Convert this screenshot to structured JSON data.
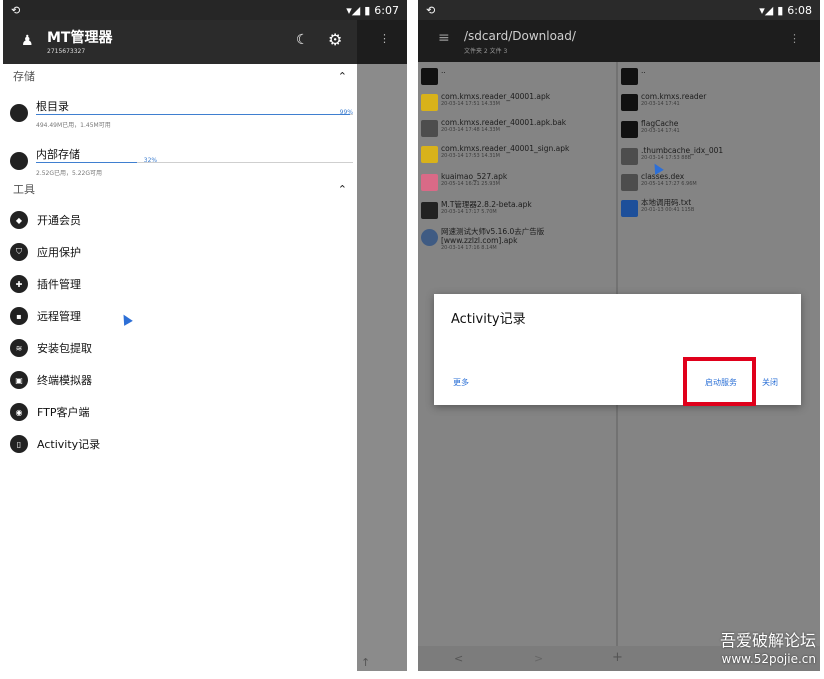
{
  "left": {
    "status": {
      "time": "6:07"
    },
    "app": {
      "title": "MT管理器",
      "subtitle": "2715673327"
    },
    "sections": {
      "storage": "存储",
      "tools": "工具"
    },
    "storage_items": [
      {
        "name": "根目录",
        "detail": "494.49M已用，1.45M可用",
        "percent_label": "99%",
        "percent": 0.99
      },
      {
        "name": "内部存储",
        "detail": "2.52G已用，5.22G可用",
        "percent_label": "32%",
        "percent": 0.32
      }
    ],
    "tools": [
      {
        "label": "开通会员",
        "icon": "diamond-icon"
      },
      {
        "label": "应用保护",
        "icon": "shield-icon"
      },
      {
        "label": "插件管理",
        "icon": "puzzle-icon"
      },
      {
        "label": "远程管理",
        "icon": "document-icon"
      },
      {
        "label": "安装包提取",
        "icon": "layers-icon"
      },
      {
        "label": "终端模拟器",
        "icon": "terminal-icon"
      },
      {
        "label": "FTP客户端",
        "icon": "wifi-icon"
      },
      {
        "label": "Activity记录",
        "icon": "phone-icon"
      }
    ]
  },
  "right": {
    "status": {
      "time": "6:08"
    },
    "appbar": {
      "path": "/sdcard/Download/",
      "subtitle": "文件夹 2 文件 3"
    },
    "left_files": [
      {
        "name": "..",
        "meta": "",
        "kind": "folder"
      },
      {
        "name": "com.kmxs.reader_40001.apk",
        "meta": "20-03-14 17:51  14.33M",
        "kind": "apk"
      },
      {
        "name": "com.kmxs.reader_40001.apk.bak",
        "meta": "20-03-14 17:48  14.33M",
        "kind": "file"
      },
      {
        "name": "com.kmxs.reader_40001_sign.apk",
        "meta": "20-03-14 17:53  14.31M",
        "kind": "apk"
      },
      {
        "name": "kuaimao_527.apk",
        "meta": "20-05-14 16:21  25.93M",
        "kind": "pink"
      },
      {
        "name": "M.T管理器2.8.2-beta.apk",
        "meta": "20-03-14 17:17  5.70M",
        "kind": "mt"
      },
      {
        "name": "网速测试大师v5.16.0去广告版[www.zzlzl.com].apk",
        "meta": "20-03-14 17:16  8.14M",
        "kind": "speed"
      }
    ],
    "right_files": [
      {
        "name": "..",
        "meta": "",
        "kind": "folder"
      },
      {
        "name": "com.kmxs.reader",
        "meta": "20-03-14 17:41",
        "kind": "folder"
      },
      {
        "name": "flagCache",
        "meta": "20-03-14 17:41",
        "kind": "folder"
      },
      {
        "name": ".thumbcache_idx_001",
        "meta": "20-03-14 17:53  88B",
        "kind": "file"
      },
      {
        "name": "classes.dex",
        "meta": "20-05-14 17:27  6.96M",
        "kind": "file"
      },
      {
        "name": "本地调用码.txt",
        "meta": "20-01-13 00:41  115B",
        "kind": "txt"
      }
    ],
    "dialog": {
      "title": "Activity记录",
      "more": "更多",
      "start": "启动服务",
      "close": "关闭"
    },
    "bottom": {
      "back": "<",
      "forward": ">",
      "add": "+"
    }
  },
  "watermark": {
    "line1": "吾爱破解论坛",
    "line2": "www.52pojie.cn"
  },
  "colors": {
    "accent": "#3f7fd0",
    "highlight": "#e0001b",
    "dialog_button": "#2a6fd6"
  }
}
